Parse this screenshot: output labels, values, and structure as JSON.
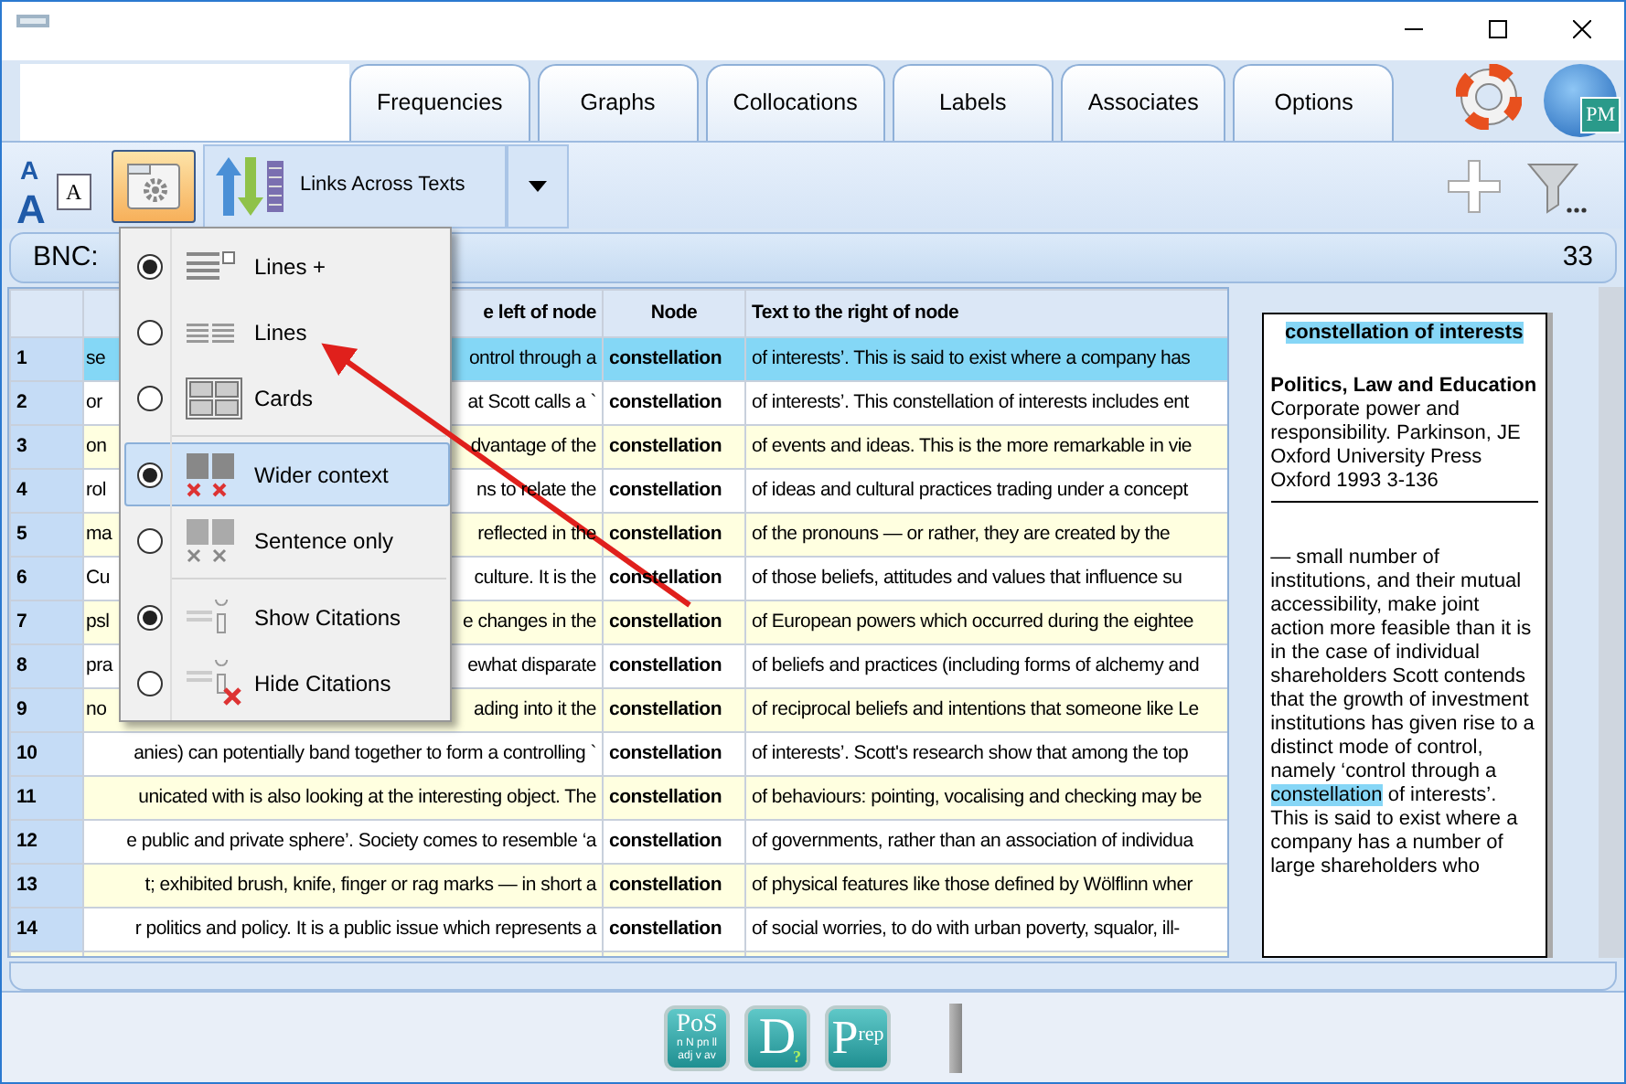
{
  "tabs": [
    {
      "label": "Frequencies"
    },
    {
      "label": "Graphs"
    },
    {
      "label": "Collocations"
    },
    {
      "label": "Labels"
    },
    {
      "label": "Associates"
    },
    {
      "label": "Options"
    }
  ],
  "globe_badge": "PM",
  "toolbar": {
    "font_letters": [
      "A",
      "A",
      "A"
    ],
    "layout_button": {
      "pressed": true
    },
    "sort_button": {
      "label": "Links Across Texts"
    }
  },
  "corpus_bar": {
    "label": "BNC:",
    "count": "33"
  },
  "table": {
    "columns": [
      "e left of node",
      "Node",
      "Text to the right of node"
    ],
    "rows": [
      {
        "number": "1",
        "left_start": "se",
        "left_end": "ontrol through a",
        "node": "constellation",
        "right": "of interests’. This is said to exist where a company has",
        "selected": true
      },
      {
        "number": "2",
        "left_start": "or",
        "left_end": "at Scott calls a `",
        "node": "constellation",
        "right": "of interests’. This constellation of interests includes ent",
        "selected": false
      },
      {
        "number": "3",
        "left_start": "on",
        "left_end": "dvantage of the",
        "node": "constellation",
        "right": "of events and ideas. This is the more remarkable in vie",
        "selected": false
      },
      {
        "number": "4",
        "left_start": "rol",
        "left_end": "ns to relate the",
        "node": "constellation",
        "right": "of ideas and cultural practices trading under a concept",
        "selected": false
      },
      {
        "number": "5",
        "left_start": "ma",
        "left_end": "reflected in the",
        "node": "constellation",
        "right": "of the pronouns — or rather, they are created by the",
        "selected": false
      },
      {
        "number": "6",
        "left_start": "Cu",
        "left_end": "culture. It is the",
        "node": "constellation",
        "right": "of those beliefs, attitudes and values that influence su",
        "selected": false
      },
      {
        "number": "7",
        "left_start": "psl",
        "left_end": "e changes in the",
        "node": "constellation",
        "right": "of European powers which occurred during the eightee",
        "selected": false
      },
      {
        "number": "8",
        "left_start": "pra",
        "left_end": "ewhat disparate",
        "node": "constellation",
        "right": "of beliefs and practices (including forms of alchemy and",
        "selected": false
      },
      {
        "number": "9",
        "left_start": "no",
        "left_end": "ading into it the",
        "node": "constellation",
        "right": "of reciprocal beliefs and intentions that someone like Le",
        "selected": false
      },
      {
        "number": "10",
        "left_end": "anies) can potentially band together to form a controlling `",
        "node": "constellation",
        "right": "of interests’. Scott's research show that among the top",
        "selected": false
      },
      {
        "number": "11",
        "left_end": "unicated with is also looking at the interesting object. The",
        "node": "constellation",
        "right": "of behaviours: pointing, vocalising and checking may be",
        "selected": false
      },
      {
        "number": "12",
        "left_end": "e public and private sphere’. Society comes to resemble ‘a",
        "node": "constellation",
        "right": "of governments, rather than an association of individua",
        "selected": false
      },
      {
        "number": "13",
        "left_end": "t; exhibited brush, knife, finger or rag marks — in short a",
        "node": "constellation",
        "right": "of physical features like those defined by Wölflinn wher",
        "selected": false
      },
      {
        "number": "14",
        "left_end": "r politics and policy. It is a public issue which represents a",
        "node": "constellation",
        "right": "of social worries, to do with urban poverty, squalor, ill-",
        "selected": false
      }
    ]
  },
  "menu": {
    "groups": [
      [
        {
          "kind": "linesplus",
          "label": "Lines +",
          "checked": true,
          "highlighted": false
        },
        {
          "kind": "lines",
          "label": "Lines",
          "checked": false,
          "highlighted": false
        },
        {
          "kind": "cards",
          "label": "Cards",
          "checked": false,
          "highlighted": false
        }
      ],
      [
        {
          "kind": "wider",
          "label": "Wider context",
          "checked": true,
          "highlighted": true
        },
        {
          "kind": "sentence",
          "label": "Sentence only",
          "checked": false,
          "highlighted": false
        }
      ],
      [
        {
          "kind": "showcit",
          "label": "Show Citations",
          "checked": true,
          "highlighted": false
        },
        {
          "kind": "hidecit",
          "label": "Hide Citations",
          "checked": false,
          "highlighted": false
        }
      ]
    ]
  },
  "citation_card": {
    "title": "constellation of interests",
    "genre": "Politics, Law and Education",
    "source": [
      "Corporate power and responsibility. Parkinson, JE",
      "Oxford University Press",
      "Oxford 1993 3-136"
    ],
    "context": {
      "before": "— small number of institutions, and their mutual accessibility, make joint action more feasible than it is in the case of individual shareholders Scott contends that the growth of investment institutions has given rise to a distinct mode of control, namely ‘control through a",
      "node": "constellation",
      "after": "of interests’. This is said to exist where a company has a number of large shareholders who"
    }
  },
  "bottom_tools": [
    {
      "kind": "pos",
      "label": "PoS",
      "sub": "n N pn ll adj v av"
    },
    {
      "kind": "d",
      "label": "D",
      "sub": "?"
    },
    {
      "kind": "prep",
      "label": "P",
      "sub": "rep"
    }
  ]
}
